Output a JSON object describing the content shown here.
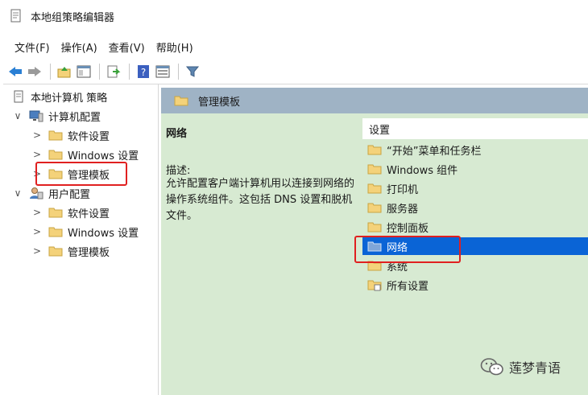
{
  "window": {
    "title": "本地组策略编辑器"
  },
  "menu": [
    "文件(F)",
    "操作(A)",
    "查看(V)",
    "帮助(H)"
  ],
  "toolbar": [
    "back-icon",
    "forward-icon",
    "up-folder-icon",
    "show-hide-tree-icon",
    "export-icon",
    "help-icon",
    "properties-icon",
    "filter-icon"
  ],
  "tree": {
    "root": "本地计算机 策略",
    "computer": "计算机配置",
    "computer_children": [
      "软件设置",
      "Windows 设置",
      "管理模板"
    ],
    "user": "用户配置",
    "user_children": [
      "软件设置",
      "Windows 设置",
      "管理模板"
    ],
    "selected": "管理模板"
  },
  "right": {
    "header": "管理模板",
    "desc_title": "网络",
    "desc_label": "描述:",
    "desc_text": "允许配置客户端计算机用以连接到网络的操作系统组件。这包括 DNS 设置和脱机文件。",
    "list_header": "设置",
    "items": [
      "“开始”菜单和任务栏",
      "Windows 组件",
      "打印机",
      "服务器",
      "控制面板",
      "网络",
      "系统",
      "所有设置"
    ],
    "selected_item": "网络"
  },
  "watermark": "莲梦青语",
  "colors": {
    "folder": "#f4d27a",
    "highlight": "#e02020",
    "selection": "#0a64d6",
    "pane_bg": "#d7ead2",
    "header_bg": "#9fb3c5"
  }
}
